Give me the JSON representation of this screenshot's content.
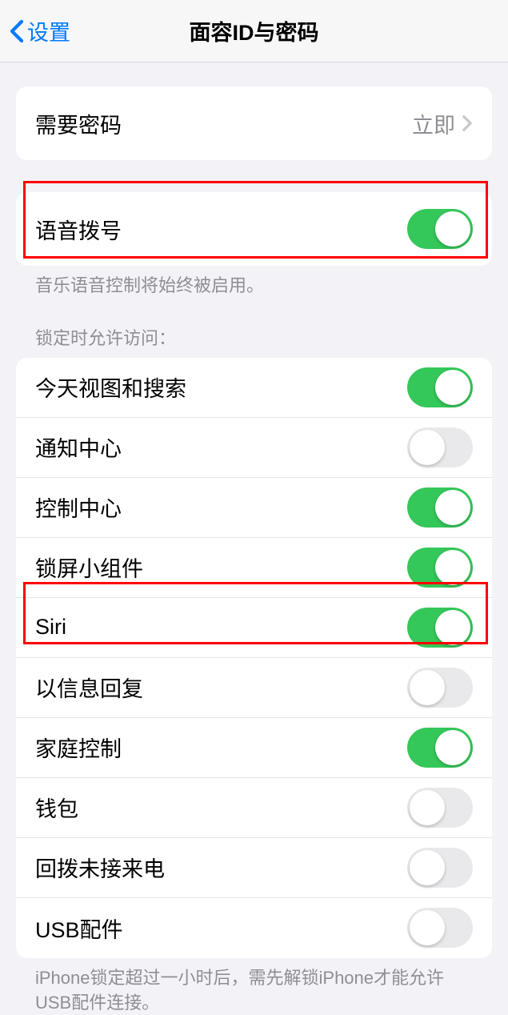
{
  "header": {
    "back_label": "设置",
    "title": "面容ID与密码"
  },
  "require_passcode": {
    "label": "需要密码",
    "value": "立即"
  },
  "voice_dial": {
    "label": "语音拨号",
    "footer": "音乐语音控制将始终被启用。",
    "on": true
  },
  "locked_section_header": "锁定时允许访问：",
  "locked_items": [
    {
      "label": "今天视图和搜索",
      "on": true
    },
    {
      "label": "通知中心",
      "on": false
    },
    {
      "label": "控制中心",
      "on": true
    },
    {
      "label": "锁屏小组件",
      "on": true
    },
    {
      "label": "Siri",
      "on": true
    },
    {
      "label": "以信息回复",
      "on": false
    },
    {
      "label": "家庭控制",
      "on": true
    },
    {
      "label": "钱包",
      "on": false
    },
    {
      "label": "回拨未接来电",
      "on": false
    },
    {
      "label": "USB配件",
      "on": false
    }
  ],
  "usb_footer": "iPhone锁定超过一小时后，需先解锁iPhone才能允许USB配件连接。"
}
